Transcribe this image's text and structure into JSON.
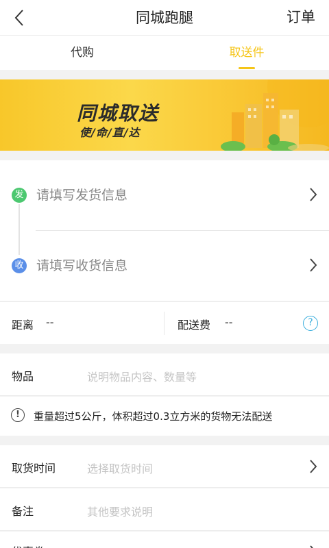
{
  "header": {
    "title": "同城跑腿",
    "right_action": "订单"
  },
  "tabs": [
    {
      "label": "代购",
      "active": false
    },
    {
      "label": "取送件",
      "active": true
    }
  ],
  "banner": {
    "title": "同城取送",
    "subtitle": "使/命/直/达"
  },
  "address": {
    "send_badge": "发",
    "send_text": "请填写发货信息",
    "recv_badge": "收",
    "recv_text": "请填写收货信息"
  },
  "fee": {
    "distance_label": "距离",
    "distance_value": "--",
    "delivery_fee_label": "配送费",
    "delivery_fee_value": "--"
  },
  "goods": {
    "label": "物品",
    "placeholder": "说明物品内容、数量等"
  },
  "notice": {
    "text": "重量超过5公斤，体积超过0.3立方米的货物无法配送"
  },
  "pickup_time": {
    "label": "取货时间",
    "placeholder": "选择取货时间"
  },
  "remark": {
    "label": "备注",
    "placeholder": "其他要求说明"
  },
  "extra": {
    "label": "优惠券"
  },
  "colors": {
    "accent": "#f5c518",
    "send_badge": "#4cc870",
    "recv_badge": "#5b8fe8",
    "help": "#3aaedd"
  }
}
